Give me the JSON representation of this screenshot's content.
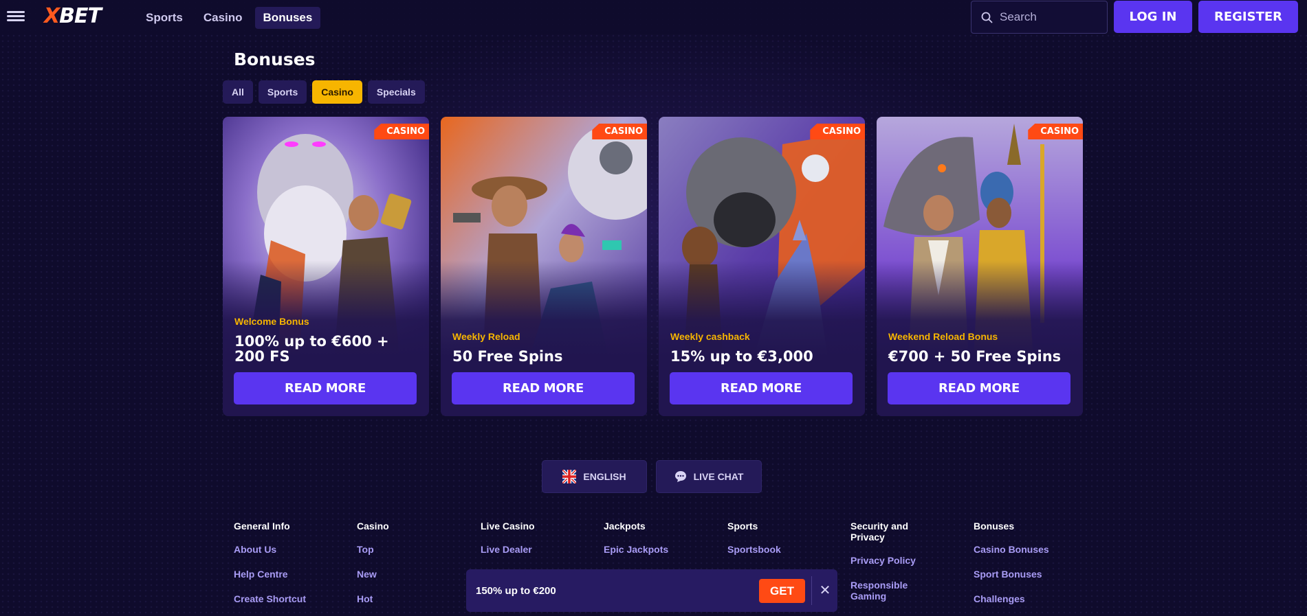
{
  "header": {
    "logo": {
      "x": "X",
      "rest": "BET"
    },
    "nav": [
      {
        "label": "Sports"
      },
      {
        "label": "Casino"
      },
      {
        "label": "Bonuses"
      }
    ],
    "search_placeholder": "Search",
    "login_label": "LOG IN",
    "register_label": "REGISTER"
  },
  "page": {
    "title": "Bonuses",
    "filters": [
      {
        "label": "All"
      },
      {
        "label": "Sports"
      },
      {
        "label": "Casino"
      },
      {
        "label": "Specials"
      }
    ],
    "active_filter": "Casino"
  },
  "cards": [
    {
      "tag": "CASINO",
      "subtitle": "Welcome Bonus",
      "title": "100% up to €600 + 200 FS",
      "button": "READ MORE"
    },
    {
      "tag": "CASINO",
      "subtitle": "Weekly Reload",
      "title": "50 Free Spins",
      "button": "READ MORE"
    },
    {
      "tag": "CASINO",
      "subtitle": "Weekly cashback",
      "title": "15% up to €3,000",
      "button": "READ MORE"
    },
    {
      "tag": "CASINO",
      "subtitle": "Weekend Reload Bonus",
      "title": "€700 + 50 Free Spins",
      "button": "READ MORE"
    }
  ],
  "language_label": "ENGLISH",
  "live_chat_label": "LIVE CHAT",
  "footer": [
    {
      "heading": "General Info",
      "links": [
        "About Us",
        "Help Centre",
        "Create Shortcut"
      ]
    },
    {
      "heading": "Casino",
      "links": [
        "Top",
        "New",
        "Hot"
      ]
    },
    {
      "heading": "Live Casino",
      "links": [
        "Live Dealer"
      ]
    },
    {
      "heading": "Jackpots",
      "links": [
        "Epic Jackpots"
      ]
    },
    {
      "heading": "Sports",
      "links": [
        "Sportsbook"
      ]
    },
    {
      "heading": "Security and Privacy",
      "links": [
        "Privacy Policy",
        "Responsible Gaming"
      ]
    },
    {
      "heading": "Bonuses",
      "links": [
        "Casino Bonuses",
        "Sport Bonuses",
        "Challenges"
      ]
    }
  ],
  "promo": {
    "text": "150% up to €200",
    "button": "GET",
    "close_icon": "close-icon"
  },
  "colors": {
    "background": "#0f0b2c",
    "accent_purple": "#5a35f0",
    "accent_orange": "#ff4a14",
    "accent_yellow": "#f7b500"
  }
}
